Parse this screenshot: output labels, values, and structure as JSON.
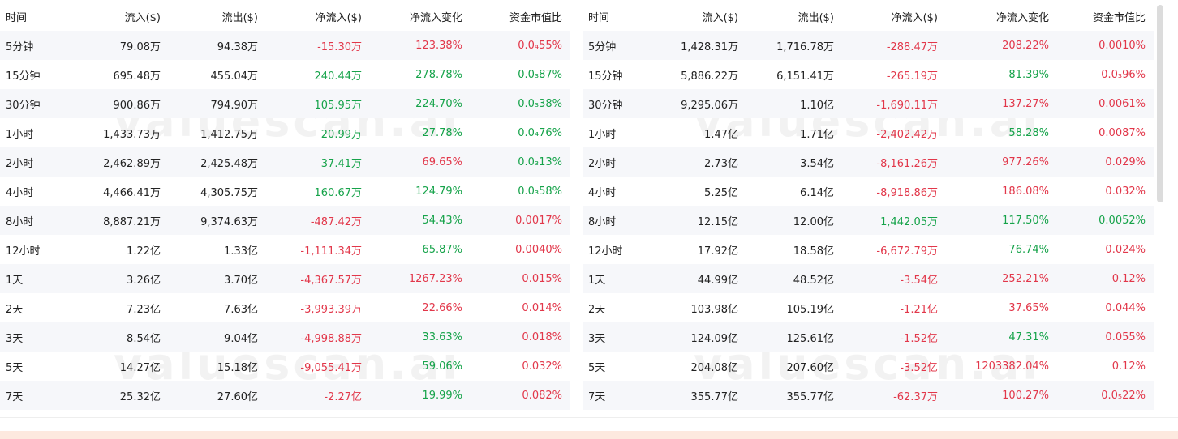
{
  "watermark": "valuescan.ai",
  "colors": {
    "positive": "#16a34a",
    "negative": "#e2374a",
    "stripe": "#f6f7fa"
  },
  "tables": [
    {
      "headers": [
        "时间",
        "流入($)",
        "流出($)",
        "净流入($)",
        "净流入变化",
        "资金市值比"
      ],
      "rows": [
        {
          "time": "5分钟",
          "inflow": "79.08万",
          "outflow": "94.38万",
          "net": "-15.30万",
          "net_sign": "neg",
          "change": "123.38%",
          "change_sign": "neg",
          "ratio": "0.0₄55%",
          "ratio_sign": "neg"
        },
        {
          "time": "15分钟",
          "inflow": "695.48万",
          "outflow": "455.04万",
          "net": "240.44万",
          "net_sign": "pos",
          "change": "278.78%",
          "change_sign": "pos",
          "ratio": "0.0₃87%",
          "ratio_sign": "pos"
        },
        {
          "time": "30分钟",
          "inflow": "900.86万",
          "outflow": "794.90万",
          "net": "105.95万",
          "net_sign": "pos",
          "change": "224.70%",
          "change_sign": "pos",
          "ratio": "0.0₃38%",
          "ratio_sign": "pos"
        },
        {
          "time": "1小时",
          "inflow": "1,433.73万",
          "outflow": "1,412.75万",
          "net": "20.99万",
          "net_sign": "pos",
          "change": "27.78%",
          "change_sign": "pos",
          "ratio": "0.0₄76%",
          "ratio_sign": "pos"
        },
        {
          "time": "2小时",
          "inflow": "2,462.89万",
          "outflow": "2,425.48万",
          "net": "37.41万",
          "net_sign": "pos",
          "change": "69.65%",
          "change_sign": "neg",
          "ratio": "0.0₃13%",
          "ratio_sign": "pos"
        },
        {
          "time": "4小时",
          "inflow": "4,466.41万",
          "outflow": "4,305.75万",
          "net": "160.67万",
          "net_sign": "pos",
          "change": "124.79%",
          "change_sign": "pos",
          "ratio": "0.0₃58%",
          "ratio_sign": "pos"
        },
        {
          "time": "8小时",
          "inflow": "8,887.21万",
          "outflow": "9,374.63万",
          "net": "-487.42万",
          "net_sign": "neg",
          "change": "54.43%",
          "change_sign": "pos",
          "ratio": "0.0017%",
          "ratio_sign": "neg"
        },
        {
          "time": "12小时",
          "inflow": "1.22亿",
          "outflow": "1.33亿",
          "net": "-1,111.34万",
          "net_sign": "neg",
          "change": "65.87%",
          "change_sign": "pos",
          "ratio": "0.0040%",
          "ratio_sign": "neg"
        },
        {
          "time": "1天",
          "inflow": "3.26亿",
          "outflow": "3.70亿",
          "net": "-4,367.57万",
          "net_sign": "neg",
          "change": "1267.23%",
          "change_sign": "neg",
          "ratio": "0.015%",
          "ratio_sign": "neg"
        },
        {
          "time": "2天",
          "inflow": "7.23亿",
          "outflow": "7.63亿",
          "net": "-3,993.39万",
          "net_sign": "neg",
          "change": "22.66%",
          "change_sign": "neg",
          "ratio": "0.014%",
          "ratio_sign": "neg"
        },
        {
          "time": "3天",
          "inflow": "8.54亿",
          "outflow": "9.04亿",
          "net": "-4,998.88万",
          "net_sign": "neg",
          "change": "33.63%",
          "change_sign": "pos",
          "ratio": "0.018%",
          "ratio_sign": "neg"
        },
        {
          "time": "5天",
          "inflow": "14.27亿",
          "outflow": "15.18亿",
          "net": "-9,055.41万",
          "net_sign": "neg",
          "change": "59.06%",
          "change_sign": "pos",
          "ratio": "0.032%",
          "ratio_sign": "neg"
        },
        {
          "time": "7天",
          "inflow": "25.32亿",
          "outflow": "27.60亿",
          "net": "-2.27亿",
          "net_sign": "neg",
          "change": "19.99%",
          "change_sign": "pos",
          "ratio": "0.082%",
          "ratio_sign": "neg"
        }
      ]
    },
    {
      "headers": [
        "时间",
        "流入($)",
        "流出($)",
        "净流入($)",
        "净流入变化",
        "资金市值比"
      ],
      "rows": [
        {
          "time": "5分钟",
          "inflow": "1,428.31万",
          "outflow": "1,716.78万",
          "net": "-288.47万",
          "net_sign": "neg",
          "change": "208.22%",
          "change_sign": "neg",
          "ratio": "0.0010%",
          "ratio_sign": "neg"
        },
        {
          "time": "15分钟",
          "inflow": "5,886.22万",
          "outflow": "6,151.41万",
          "net": "-265.19万",
          "net_sign": "neg",
          "change": "81.39%",
          "change_sign": "pos",
          "ratio": "0.0₃96%",
          "ratio_sign": "neg"
        },
        {
          "time": "30分钟",
          "inflow": "9,295.06万",
          "outflow": "1.10亿",
          "net": "-1,690.11万",
          "net_sign": "neg",
          "change": "137.27%",
          "change_sign": "neg",
          "ratio": "0.0061%",
          "ratio_sign": "neg"
        },
        {
          "time": "1小时",
          "inflow": "1.47亿",
          "outflow": "1.71亿",
          "net": "-2,402.42万",
          "net_sign": "neg",
          "change": "58.28%",
          "change_sign": "pos",
          "ratio": "0.0087%",
          "ratio_sign": "neg"
        },
        {
          "time": "2小时",
          "inflow": "2.73亿",
          "outflow": "3.54亿",
          "net": "-8,161.26万",
          "net_sign": "neg",
          "change": "977.26%",
          "change_sign": "neg",
          "ratio": "0.029%",
          "ratio_sign": "neg"
        },
        {
          "time": "4小时",
          "inflow": "5.25亿",
          "outflow": "6.14亿",
          "net": "-8,918.86万",
          "net_sign": "neg",
          "change": "186.08%",
          "change_sign": "neg",
          "ratio": "0.032%",
          "ratio_sign": "neg"
        },
        {
          "time": "8小时",
          "inflow": "12.15亿",
          "outflow": "12.00亿",
          "net": "1,442.05万",
          "net_sign": "pos",
          "change": "117.50%",
          "change_sign": "pos",
          "ratio": "0.0052%",
          "ratio_sign": "pos"
        },
        {
          "time": "12小时",
          "inflow": "17.92亿",
          "outflow": "18.58亿",
          "net": "-6,672.79万",
          "net_sign": "neg",
          "change": "76.74%",
          "change_sign": "pos",
          "ratio": "0.024%",
          "ratio_sign": "neg"
        },
        {
          "time": "1天",
          "inflow": "44.99亿",
          "outflow": "48.52亿",
          "net": "-3.54亿",
          "net_sign": "neg",
          "change": "252.21%",
          "change_sign": "neg",
          "ratio": "0.12%",
          "ratio_sign": "neg"
        },
        {
          "time": "2天",
          "inflow": "103.98亿",
          "outflow": "105.19亿",
          "net": "-1.21亿",
          "net_sign": "neg",
          "change": "37.65%",
          "change_sign": "neg",
          "ratio": "0.044%",
          "ratio_sign": "neg"
        },
        {
          "time": "3天",
          "inflow": "124.09亿",
          "outflow": "125.61亿",
          "net": "-1.52亿",
          "net_sign": "neg",
          "change": "47.31%",
          "change_sign": "pos",
          "ratio": "0.055%",
          "ratio_sign": "neg"
        },
        {
          "time": "5天",
          "inflow": "204.08亿",
          "outflow": "207.60亿",
          "net": "-3.52亿",
          "net_sign": "neg",
          "change": "1203382.04%",
          "change_sign": "neg",
          "ratio": "0.12%",
          "ratio_sign": "neg"
        },
        {
          "time": "7天",
          "inflow": "355.77亿",
          "outflow": "355.77亿",
          "net": "-62.37万",
          "net_sign": "neg",
          "change": "100.27%",
          "change_sign": "neg",
          "ratio": "0.0₅22%",
          "ratio_sign": "neg"
        }
      ]
    }
  ]
}
